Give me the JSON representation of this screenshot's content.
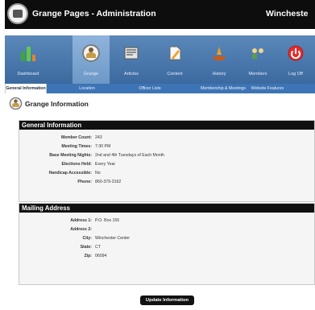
{
  "app": {
    "title": "Grange Pages - Administration",
    "title_right": "Wincheste"
  },
  "nav": {
    "items": [
      {
        "label": "Dashboard",
        "icon": "dashboard-icon",
        "active": false
      },
      {
        "label": "Grange",
        "icon": "grange-icon",
        "active": true
      },
      {
        "label": "Articles",
        "icon": "articles-icon",
        "active": false
      },
      {
        "label": "Content",
        "icon": "content-icon",
        "active": false
      },
      {
        "label": "History",
        "icon": "history-icon",
        "active": false
      },
      {
        "label": "Members",
        "icon": "members-icon",
        "active": false
      },
      {
        "label": "Log Off",
        "icon": "log-off-icon",
        "active": false
      }
    ]
  },
  "tabs": [
    {
      "label": "General Information",
      "active": true
    },
    {
      "label": "Location",
      "active": false
    },
    {
      "label": "Officer Lists",
      "active": false
    },
    {
      "label": "Membership & Meetings",
      "active": false
    },
    {
      "label": "Website Features",
      "active": false
    }
  ],
  "page": {
    "title": "Grange Information"
  },
  "general": {
    "heading": "General Information",
    "rows": [
      {
        "label": "Member Count:",
        "value": "243"
      },
      {
        "label": "Meeting Times:",
        "value": "7:30 PM"
      },
      {
        "label": "Base Meeting Nights:",
        "value": "2nd and 4th Tuesdays of Each Month"
      },
      {
        "label": "Elections Held:",
        "value": "Every Year"
      },
      {
        "label": "Handicap Accessible:",
        "value": "No"
      },
      {
        "label": "Phone:",
        "value": "860-379-3162"
      }
    ]
  },
  "mailing": {
    "heading": "Mailing Address",
    "rows": [
      {
        "label": "Address 1:",
        "value": "P.O. Box 155"
      },
      {
        "label": "Address 2:",
        "value": ""
      },
      {
        "label": "City:",
        "value": "Winchester Center"
      },
      {
        "label": "State:",
        "value": "CT"
      },
      {
        "label": "Zip:",
        "value": "06094"
      }
    ]
  },
  "actions": {
    "update_label": "Update Information"
  }
}
